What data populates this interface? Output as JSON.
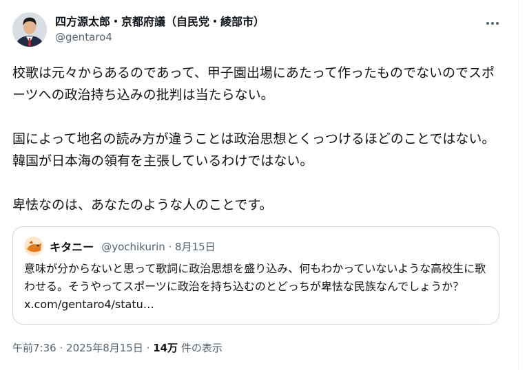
{
  "author": {
    "display_name": "四方源太郎・京都府議（自民党・綾部市）",
    "handle": "@gentaro4"
  },
  "more_icon": "more-horizontal-icon",
  "tweet_text": "校歌は元々からあるのであって、甲子園出場にあたって作ったものでないのでスポーツへの政治持ち込みの批判は当たらない。\n\n国によって地名の読み方が違うことは政治思想とくっつけるほどのことではない。韓国が日本海の領有を主張しているわけではない。\n\n卑怯なのは、あなたのような人のことです。",
  "quote": {
    "display_name": "キタニー",
    "handle_date": "@yochikurin · 8月15日",
    "text": "意味が分からないと思って歌詞に政治思想を盛り込み、何もわかっていないような高校生に歌わせる。そうやってスポーツに政治を持ち込むのとどっちが卑怯な民族なんでしょうか？ ",
    "link": "x.com/gentaro4/statu…"
  },
  "meta": {
    "time": "午前7:36",
    "separator": "·",
    "date": "2025年8月15日",
    "views_count": "14万",
    "views_label": "件の表示"
  },
  "colors": {
    "text": "#0f1419",
    "secondary": "#536471",
    "border": "#cfd9de"
  }
}
